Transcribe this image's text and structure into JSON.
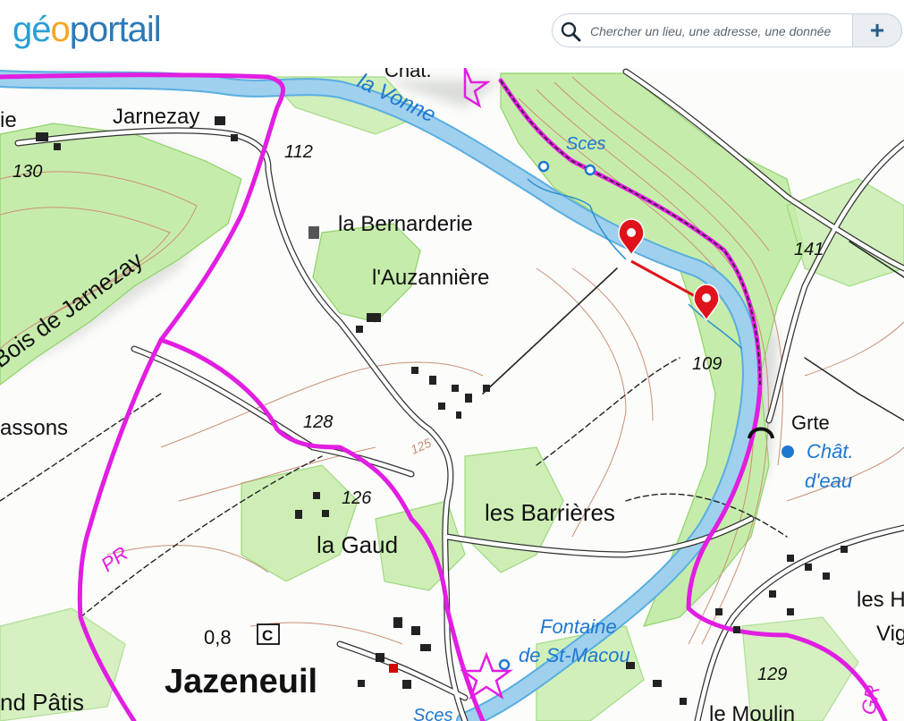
{
  "header": {
    "logo": {
      "part1": "géo",
      "part2": "portail",
      "color_ge": "#2a9fd6",
      "color_o": "#f5a623",
      "color_portail": "#2a7ab8"
    },
    "search": {
      "placeholder": "Chercher un lieu, une adresse, une donnée",
      "value": "",
      "add_label": "+"
    }
  },
  "map": {
    "colors": {
      "forest": "#c6ecab",
      "forest_edge": "#8ed36a",
      "river": "#9fd0ee",
      "river_edge": "#5aaee0",
      "trail": "#e11ee1",
      "contour": "#c98f78",
      "road": "#ffffff",
      "marker": "#e0121b"
    },
    "labels": {
      "jarnezay": "Jarnezay",
      "alt112": "112",
      "alt130": "130",
      "bois": "Bois de Jarnezay",
      "bernarderie": "la Bernarderie",
      "auzanniere": "l'Auzannière",
      "la_vonne": "la Vonne",
      "sces1": "Sces",
      "chat_top": "Chat.",
      "alt141": "141",
      "alt109": "109",
      "grte": "Grte",
      "chat_eau_1": "Chât.",
      "chat_eau_2": "d'eau",
      "alt128": "128",
      "assons": "assons",
      "alt125": "125",
      "alt126": "126",
      "barrieres": "les Barrières",
      "la_gaud": "la Gaud",
      "pr": "PR",
      "dist": "0,8",
      "c_symbol": "C",
      "jazeneuil": "Jazeneuil",
      "fontaine1": "Fontaine",
      "fontaine2": "de St-Macou",
      "sces2": "Sces",
      "alt129": "129",
      "les_h": "les H",
      "vig": "Vig",
      "moulin": "le Moulin",
      "patis": "nd Pâtis",
      "ie": "ie",
      "gr": "GR"
    },
    "markers": [
      {
        "name": "marker-start"
      },
      {
        "name": "marker-end"
      }
    ]
  }
}
